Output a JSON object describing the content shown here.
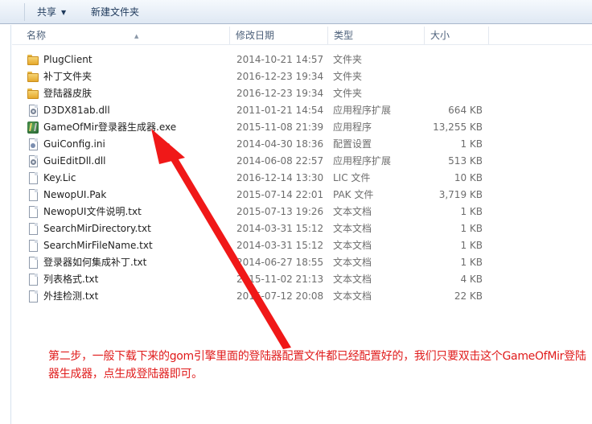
{
  "toolbar": {
    "items": [
      {
        "label": "共享",
        "has_menu": true
      },
      {
        "label": "新建文件夹",
        "has_menu": false
      }
    ]
  },
  "columns": {
    "name": "名称",
    "date": "修改日期",
    "type": "类型",
    "size": "大小"
  },
  "files": [
    {
      "name": "PlugClient",
      "date": "2014-10-21 14:57",
      "type": "文件夹",
      "size": "",
      "icon": "folder-icon"
    },
    {
      "name": "补丁文件夹",
      "date": "2016-12-23 19:34",
      "type": "文件夹",
      "size": "",
      "icon": "folder-icon"
    },
    {
      "name": "登陆器皮肤",
      "date": "2016-12-23 19:34",
      "type": "文件夹",
      "size": "",
      "icon": "folder-icon"
    },
    {
      "name": "D3DX81ab.dll",
      "date": "2011-01-21 14:54",
      "type": "应用程序扩展",
      "size": "664 KB",
      "icon": "dll-icon"
    },
    {
      "name": "GameOfMir登录器生成器.exe",
      "date": "2015-11-08 21:39",
      "type": "应用程序",
      "size": "13,255 KB",
      "icon": "exe-icon"
    },
    {
      "name": "GuiConfig.ini",
      "date": "2014-04-30 18:36",
      "type": "配置设置",
      "size": "1 KB",
      "icon": "ini-icon"
    },
    {
      "name": "GuiEditDll.dll",
      "date": "2014-06-08 22:57",
      "type": "应用程序扩展",
      "size": "513 KB",
      "icon": "dll-icon"
    },
    {
      "name": "Key.Lic",
      "date": "2016-12-14 13:30",
      "type": "LIC 文件",
      "size": "10 KB",
      "icon": "file-icon"
    },
    {
      "name": "NewopUI.Pak",
      "date": "2015-07-14 22:01",
      "type": "PAK 文件",
      "size": "3,719 KB",
      "icon": "file-icon"
    },
    {
      "name": "NewopUI文件说明.txt",
      "date": "2015-07-13 19:26",
      "type": "文本文档",
      "size": "1 KB",
      "icon": "txt-icon"
    },
    {
      "name": "SearchMirDirectory.txt",
      "date": "2014-03-31 15:12",
      "type": "文本文档",
      "size": "1 KB",
      "icon": "txt-icon"
    },
    {
      "name": "SearchMirFileName.txt",
      "date": "2014-03-31 15:12",
      "type": "文本文档",
      "size": "1 KB",
      "icon": "txt-icon"
    },
    {
      "name": "登录器如何集成补丁.txt",
      "date": "2014-06-27 18:55",
      "type": "文本文档",
      "size": "1 KB",
      "icon": "txt-icon"
    },
    {
      "name": "列表格式.txt",
      "date": "2015-11-02 21:13",
      "type": "文本文档",
      "size": "4 KB",
      "icon": "txt-icon"
    },
    {
      "name": "外挂检测.txt",
      "date": "2015-07-12 20:08",
      "type": "文本文档",
      "size": "22 KB",
      "icon": "txt-icon"
    }
  ],
  "annotation": {
    "text": "第二步，一般下载下来的gom引擎里面的登陆器配置文件都已经配置好的，我们只要双击这个GameOfMir登陆器生成器，点生成登陆器即可。",
    "color": "#e01b1b"
  }
}
